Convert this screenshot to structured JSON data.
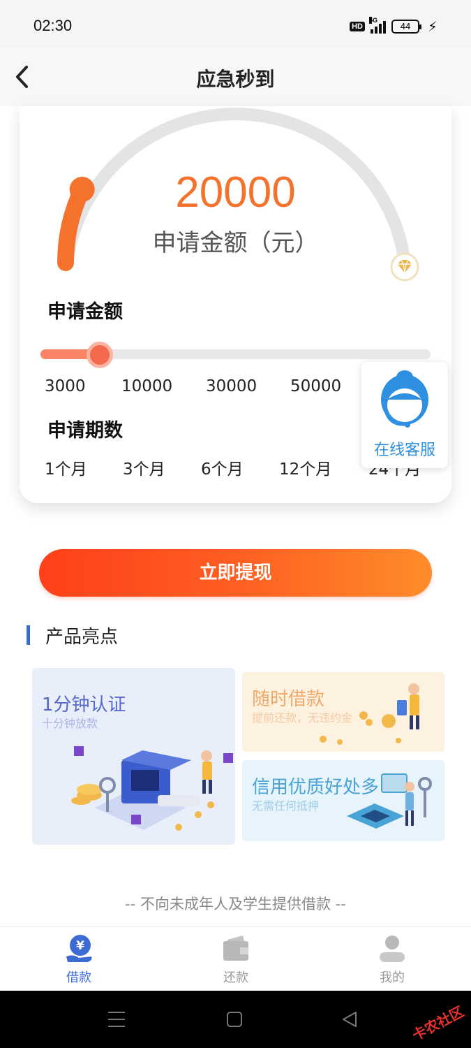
{
  "status_bar": {
    "time": "02:30",
    "hd": "HD",
    "network": "5G",
    "battery": "44"
  },
  "nav": {
    "title": "应急秒到",
    "back_icon": "chevron-left-icon"
  },
  "loan": {
    "amount": "20000",
    "amount_label": "申请金额（元）",
    "amount_fraction": 0.1,
    "amount_section_label": "申请金额",
    "amount_ticks": [
      "3000",
      "10000",
      "30000",
      "50000"
    ],
    "slider_fraction": 0.08,
    "term_section_label": "申请期数",
    "term_options": [
      "1个月",
      "3个月",
      "6个月",
      "12个月",
      "24个月"
    ],
    "max_icon": "diamond-icon"
  },
  "customer_service": {
    "label": "在线客服",
    "icon": "headset-agent-icon"
  },
  "cta": {
    "label": "立即提现"
  },
  "features": {
    "title": "产品亮点",
    "tiles": [
      {
        "title": "1分钟认证",
        "subtitle": "十分钟放款",
        "title_color": "#5468c9",
        "subtitle_color": "#a9b4e6"
      },
      {
        "title": "随时借款",
        "subtitle": "提前还款，无违约金",
        "title_color": "#f0a86a",
        "subtitle_color": "#f6caa3"
      },
      {
        "title": "信用优质好处多",
        "subtitle": "无需任何抵押",
        "title_color": "#4aa3d6",
        "subtitle_color": "#9ccbe6"
      }
    ]
  },
  "disclaimer": "-- 不向未成年人及学生提供借款 --",
  "tabs": [
    {
      "label": "借款",
      "icon": "yuan-hand-icon",
      "active": true
    },
    {
      "label": "还款",
      "icon": "wallet-icon",
      "active": false
    },
    {
      "label": "我的",
      "icon": "user-icon",
      "active": false
    }
  ],
  "colors": {
    "accent": "#f4722b",
    "tab_active": "#3d6bd6",
    "tab_inactive": "#999999"
  },
  "watermark": "卡农社区"
}
